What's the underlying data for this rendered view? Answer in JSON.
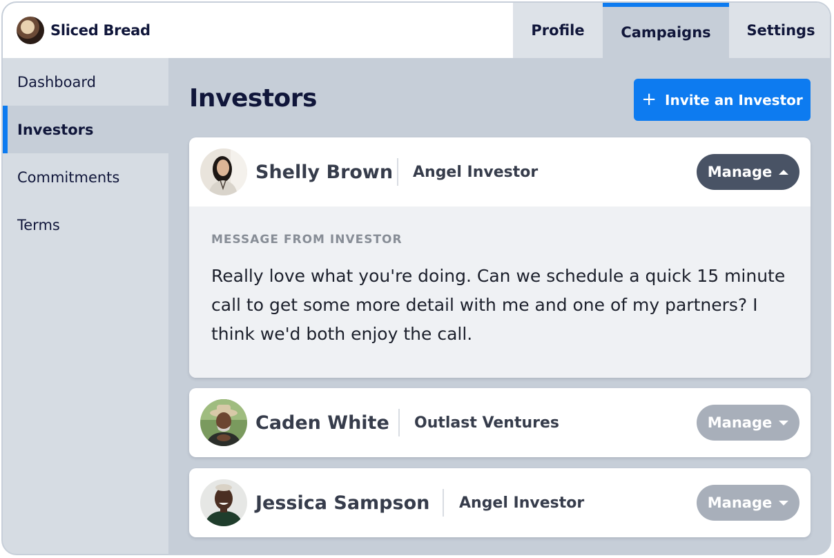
{
  "app": {
    "name": "Sliced Bread"
  },
  "tabs": [
    {
      "label": "Profile"
    },
    {
      "label": "Campaigns",
      "active": true
    },
    {
      "label": "Settings"
    }
  ],
  "sidebar": {
    "items": [
      {
        "label": "Dashboard"
      },
      {
        "label": "Investors",
        "active": true
      },
      {
        "label": "Commitments"
      },
      {
        "label": "Terms"
      }
    ]
  },
  "main": {
    "title": "Investors",
    "invite_label": "Invite an Investor",
    "invite_icon": "plus-icon"
  },
  "investors": [
    {
      "name": "Shelly Brown",
      "type": "Angel Investor",
      "manage_label": "Manage",
      "expanded": true,
      "message_label": "MESSAGE FROM INVESTOR",
      "message": "Really love what you're doing. Can we schedule a quick 15 minute call to get some more detail with me and one of my partners? I think we'd both enjoy the call."
    },
    {
      "name": "Caden White",
      "type": "Outlast Ventures",
      "manage_label": "Manage",
      "expanded": false
    },
    {
      "name": "Jessica Sampson",
      "type": "Angel Investor",
      "manage_label": "Manage",
      "expanded": false
    }
  ],
  "colors": {
    "accent": "#0d7bf0",
    "nav_text": "#10163a",
    "manage_open": "#495365",
    "manage_closed": "#a8afba"
  }
}
